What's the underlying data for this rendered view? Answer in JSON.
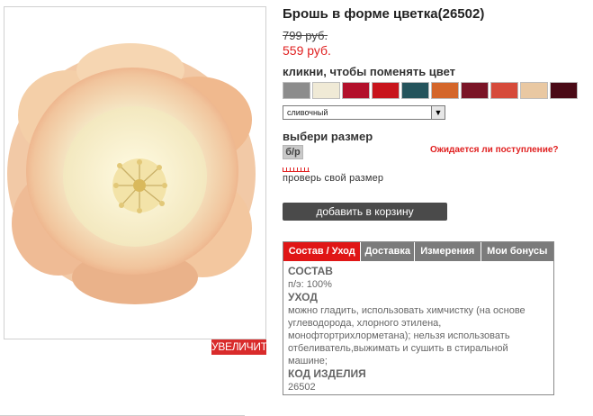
{
  "product": {
    "title": "Брошь в форме цветка(26502)",
    "old_price": "799 руб.",
    "new_price": "559 руб.",
    "zoom_label": "УВЕЛИЧИТЬ"
  },
  "color": {
    "label": "кликни, чтобы поменять цвет",
    "swatches": [
      {
        "name": "grey",
        "color": "#8c8c8c"
      },
      {
        "name": "cream",
        "color": "#f0ead6"
      },
      {
        "name": "crimson",
        "color": "#b3102b"
      },
      {
        "name": "red",
        "color": "#c8141c"
      },
      {
        "name": "teal",
        "color": "#24545c"
      },
      {
        "name": "orange",
        "color": "#d4662a"
      },
      {
        "name": "burgundy",
        "color": "#7a1426"
      },
      {
        "name": "coral",
        "color": "#d64a3a"
      },
      {
        "name": "peach",
        "color": "#e9c8a2"
      },
      {
        "name": "dark-red",
        "color": "#4a0a16"
      }
    ],
    "selected": "сливочный"
  },
  "size": {
    "label": "выбери размер",
    "value": "б/р",
    "notify_label": "Ожидается ли поступление?",
    "check_label": "проверь свой размер"
  },
  "cart": {
    "add_label": "добавить в корзину"
  },
  "tabs": [
    {
      "label": "Состав / Уход",
      "active": true
    },
    {
      "label": "Доставка",
      "active": false
    },
    {
      "label": "Измерения",
      "active": false
    },
    {
      "label": "Мои бонусы",
      "active": false
    }
  ],
  "details": {
    "composition_title": "СОСТАВ",
    "composition_text": "п/э: 100%",
    "care_title": "УХОД",
    "care_text": "можно гладить, использовать химчистку (на основе углеводорода, хлорного этилена, монофтортрихлорметана); нельзя использовать отбеливатель,выжимать и сушить в стиральной машине;",
    "code_title": "КОД ИЗДЕЛИЯ",
    "code_text": "26502"
  },
  "colors": {
    "accent": "#e01616",
    "tab_inactive": "#7b7b7b",
    "button_dark": "#4a4a4a"
  }
}
